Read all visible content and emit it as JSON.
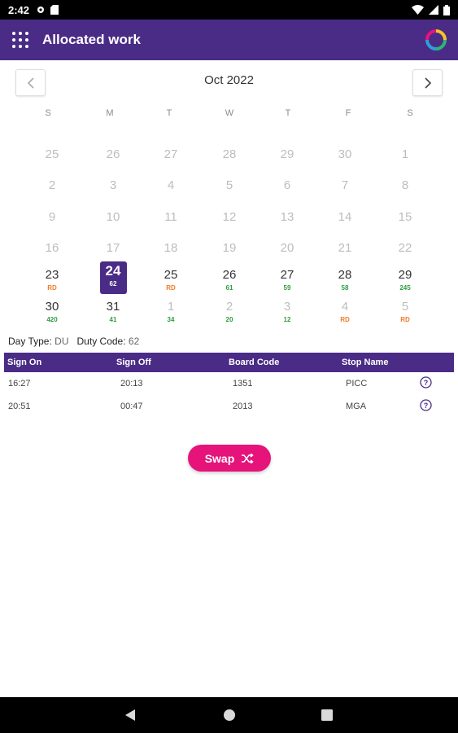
{
  "status": {
    "time": "2:42"
  },
  "appbar": {
    "title": "Allocated work"
  },
  "calendar": {
    "month_label": "Oct 2022",
    "weekdays": [
      "S",
      "M",
      "T",
      "W",
      "T",
      "F",
      "S"
    ],
    "weeks": [
      [
        {
          "d": "25",
          "m": true,
          "s": ""
        },
        {
          "d": "26",
          "m": true,
          "s": ""
        },
        {
          "d": "27",
          "m": true,
          "s": ""
        },
        {
          "d": "28",
          "m": true,
          "s": ""
        },
        {
          "d": "29",
          "m": true,
          "s": ""
        },
        {
          "d": "30",
          "m": true,
          "s": ""
        },
        {
          "d": "1",
          "m": true,
          "s": ""
        }
      ],
      [
        {
          "d": "2",
          "m": true,
          "s": ""
        },
        {
          "d": "3",
          "m": true,
          "s": ""
        },
        {
          "d": "4",
          "m": true,
          "s": ""
        },
        {
          "d": "5",
          "m": true,
          "s": ""
        },
        {
          "d": "6",
          "m": true,
          "s": ""
        },
        {
          "d": "7",
          "m": true,
          "s": ""
        },
        {
          "d": "8",
          "m": true,
          "s": ""
        }
      ],
      [
        {
          "d": "9",
          "m": true,
          "s": ""
        },
        {
          "d": "10",
          "m": true,
          "s": ""
        },
        {
          "d": "11",
          "m": true,
          "s": ""
        },
        {
          "d": "12",
          "m": true,
          "s": ""
        },
        {
          "d": "13",
          "m": true,
          "s": ""
        },
        {
          "d": "14",
          "m": true,
          "s": ""
        },
        {
          "d": "15",
          "m": true,
          "s": ""
        }
      ],
      [
        {
          "d": "16",
          "m": true,
          "s": ""
        },
        {
          "d": "17",
          "m": true,
          "s": ""
        },
        {
          "d": "18",
          "m": true,
          "s": ""
        },
        {
          "d": "19",
          "m": true,
          "s": ""
        },
        {
          "d": "20",
          "m": true,
          "s": ""
        },
        {
          "d": "21",
          "m": true,
          "s": ""
        },
        {
          "d": "22",
          "m": true,
          "s": ""
        }
      ],
      [
        {
          "d": "23",
          "m": false,
          "s": "RD",
          "c": "orange"
        },
        {
          "d": "24",
          "m": false,
          "s": "62",
          "sel": true
        },
        {
          "d": "25",
          "m": false,
          "s": "RD",
          "c": "orange"
        },
        {
          "d": "26",
          "m": false,
          "s": "61",
          "c": "green"
        },
        {
          "d": "27",
          "m": false,
          "s": "59",
          "c": "green"
        },
        {
          "d": "28",
          "m": false,
          "s": "58",
          "c": "green"
        },
        {
          "d": "29",
          "m": false,
          "s": "245",
          "c": "green"
        }
      ],
      [
        {
          "d": "30",
          "m": false,
          "s": "420",
          "c": "green"
        },
        {
          "d": "31",
          "m": false,
          "s": "41",
          "c": "green"
        },
        {
          "d": "1",
          "m": true,
          "s": "34",
          "c": "green"
        },
        {
          "d": "2",
          "m": true,
          "s": "20",
          "c": "green"
        },
        {
          "d": "3",
          "m": true,
          "s": "12",
          "c": "green"
        },
        {
          "d": "4",
          "m": true,
          "s": "RD",
          "c": "orange"
        },
        {
          "d": "5",
          "m": true,
          "s": "RD",
          "c": "orange"
        }
      ]
    ]
  },
  "duty": {
    "day_type_label": "Day Type:",
    "day_type_value": "DU",
    "duty_code_label": "Duty Code:",
    "duty_code_value": "62"
  },
  "table": {
    "headers": [
      "Sign On",
      "Sign Off",
      "Board Code",
      "Stop Name"
    ],
    "rows": [
      [
        "16:27",
        "20:13",
        "1351",
        "PICC"
      ],
      [
        "20:51",
        "00:47",
        "2013",
        "MGA"
      ]
    ]
  },
  "actions": {
    "swap_label": "Swap"
  },
  "colors": {
    "primary": "#4a2c86",
    "accent": "#e5137a",
    "green": "#2e9e3e",
    "orange": "#ef7b2a"
  }
}
